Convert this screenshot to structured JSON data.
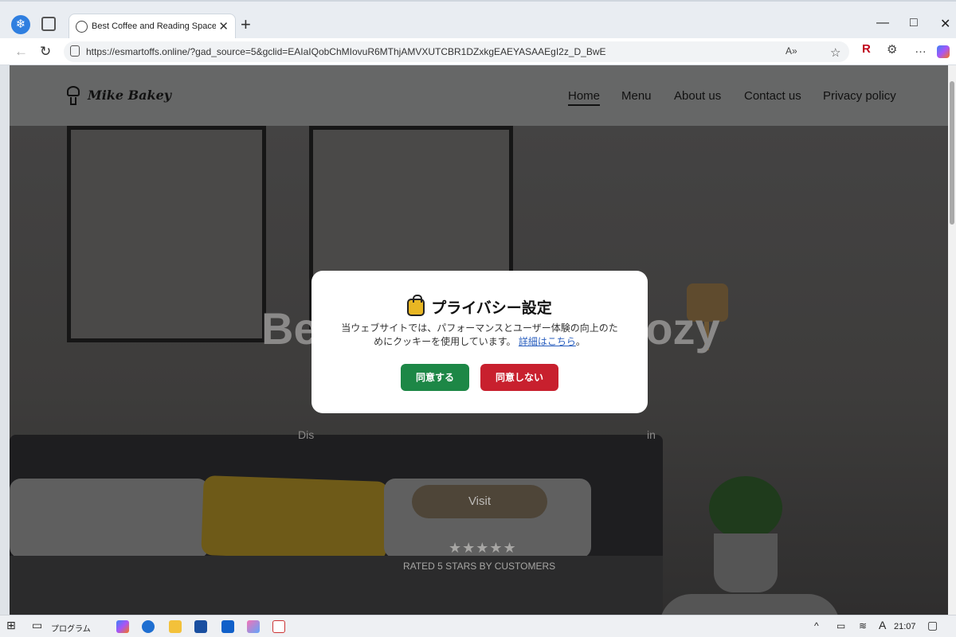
{
  "browser": {
    "tab_title": "Best Coffee and Reading Space in",
    "url": "https://esmartoffs.online/?gad_source=5&gclid=EAIaIQobChMIovuR6MThjAMVXUTCBR1DZxkgEAEYASAAEgI2z_D_BwE",
    "new_tab": "+",
    "tab_close": "✕",
    "nav": {
      "back": "←",
      "reload": "↻"
    },
    "window_controls": [
      "—",
      "□",
      "✕"
    ],
    "toolbar_icons": [
      "A»",
      "☆",
      "R",
      "⚙",
      "…"
    ]
  },
  "site": {
    "logo_text": "Mike Bakey",
    "nav": [
      "Home",
      "Menu",
      "About us",
      "Contact us",
      "Privacy policy"
    ],
    "hero_title": "Best Coffee and Cozy",
    "hero_sub_left": "Dis",
    "hero_sub_right": "in",
    "visit_label": "Visit",
    "stars": "★★★★★",
    "rated_text": "RATED 5 STARS BY CUSTOMERS"
  },
  "modal": {
    "title": "プライバシー設定",
    "body_line1": "当ウェブサイトでは、パフォーマンスとユーザー体験の向上のた",
    "body_line2": "めにクッキーを使用しています。",
    "link_text": "詳細はこちら",
    "period": "。",
    "agree_label": "同意する",
    "decline_label": "同意しない",
    "agree_color": "#1d8746",
    "decline_color": "#c8202e"
  },
  "taskbar": {
    "program_label": "プログラム",
    "time": "21:07",
    "ime": "A"
  }
}
